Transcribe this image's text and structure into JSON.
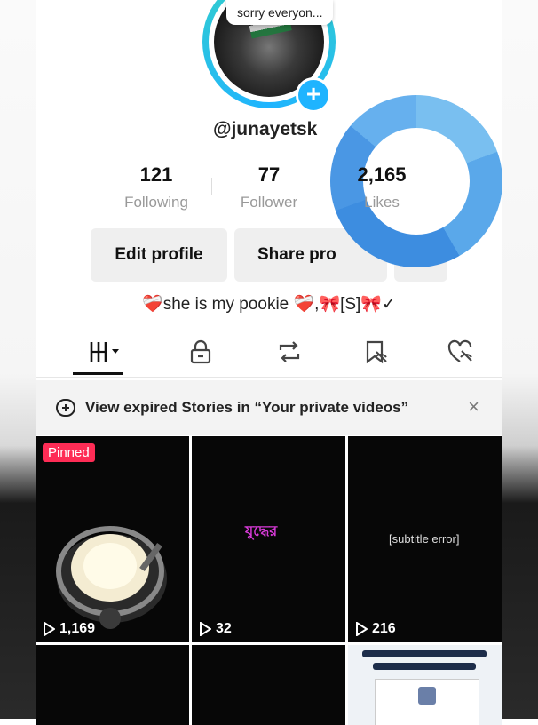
{
  "profile": {
    "note": "sorry everyon...",
    "username": "@junayetsk",
    "bio": "❤️‍🩹she is my pookie ❤️‍🩹,🎀[S]🎀✓"
  },
  "stats": {
    "following": {
      "value": "121",
      "label": "Following"
    },
    "followers": {
      "value": "77",
      "label": "Follower"
    },
    "likes": {
      "value": "2,165",
      "label": "Likes"
    }
  },
  "buttons": {
    "edit_profile": "Edit profile",
    "share_profile": "Share pro",
    "add_friends_icon": "+"
  },
  "tabs": [
    {
      "name": "videos-grid",
      "active": true
    },
    {
      "name": "private",
      "active": false
    },
    {
      "name": "reposts",
      "active": false
    },
    {
      "name": "favorites",
      "active": false
    },
    {
      "name": "liked",
      "active": false
    }
  ],
  "banner": {
    "text": "View expired Stories in “Your private videos”",
    "close": "×"
  },
  "videos": [
    {
      "pinned_label": "Pinned",
      "views": "1,169",
      "caption": ""
    },
    {
      "pinned_label": "",
      "views": "32",
      "caption": "যুদ্ধের"
    },
    {
      "pinned_label": "",
      "views": "216",
      "caption": "[subtitle error]"
    }
  ],
  "colors": {
    "accent": "#fe2c55",
    "ring": "#1fb4ff",
    "likes_ring": "#3d8de0"
  }
}
